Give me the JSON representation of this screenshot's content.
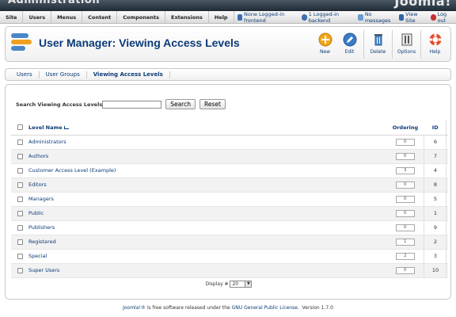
{
  "header": {
    "app_title": "Administration",
    "brand": "Joomla!"
  },
  "menu": [
    "Site",
    "Users",
    "Menus",
    "Content",
    "Components",
    "Extensions",
    "Help"
  ],
  "status": {
    "frontend": "None Logged-in frontend",
    "backend": "1 Logged-in backend",
    "messages": "No messages",
    "view_site": "View Site",
    "logout": "Log out"
  },
  "page": {
    "title": "User Manager: Viewing Access Levels"
  },
  "toolbar": {
    "new": "New",
    "edit": "Edit",
    "delete": "Delete",
    "options": "Options",
    "help": "Help"
  },
  "subnav": [
    "Users",
    "User Groups",
    "Viewing Access Levels"
  ],
  "filter": {
    "label": "Search Viewing Access Levels",
    "value": "",
    "search_button": "Search",
    "reset_button": "Reset"
  },
  "table": {
    "headers": {
      "name": "Level Name",
      "ordering": "Ordering",
      "id": "ID"
    },
    "rows": [
      {
        "name": "Administrators",
        "ordering": "0",
        "id": "6"
      },
      {
        "name": "Authors",
        "ordering": "0",
        "id": "7"
      },
      {
        "name": "Customer Access Level (Example)",
        "ordering": "3",
        "id": "4"
      },
      {
        "name": "Editors",
        "ordering": "0",
        "id": "8"
      },
      {
        "name": "Managers",
        "ordering": "0",
        "id": "5"
      },
      {
        "name": "Public",
        "ordering": "0",
        "id": "1"
      },
      {
        "name": "Publishers",
        "ordering": "0",
        "id": "9"
      },
      {
        "name": "Registered",
        "ordering": "1",
        "id": "2"
      },
      {
        "name": "Special",
        "ordering": "2",
        "id": "3"
      },
      {
        "name": "Super Users",
        "ordering": "0",
        "id": "10"
      }
    ]
  },
  "pager": {
    "label": "Display #",
    "value": "20"
  },
  "footer": {
    "joomla": "Joomla!®",
    "text": " is free software released under the ",
    "license": "GNU General Public License.",
    "version": "Version 1.7.0"
  },
  "colors": {
    "accent": "#0b3b77",
    "header_dark": "#1f2a34"
  }
}
